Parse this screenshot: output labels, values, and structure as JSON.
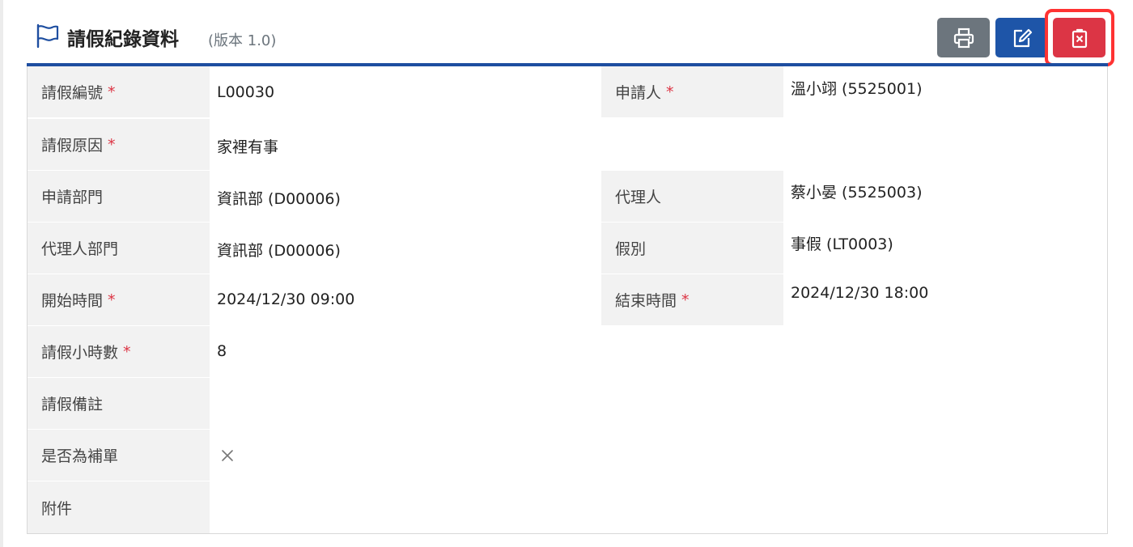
{
  "header": {
    "title": "請假紀錄資料",
    "version": "(版本 1.0)"
  },
  "toolbar": {
    "print_icon": "printer-icon",
    "edit_icon": "edit-icon",
    "delete_icon": "delete-icon"
  },
  "form": {
    "required_mark": "*",
    "fields": {
      "leave_no": {
        "label": "請假編號",
        "value": "L00030"
      },
      "applicant": {
        "label": "申請人",
        "value": "溫小翊 (5525001)"
      },
      "reason": {
        "label": "請假原因",
        "value": "家裡有事"
      },
      "dept": {
        "label": "申請部門",
        "value": "資訊部 (D00006)"
      },
      "agent": {
        "label": "代理人",
        "value": "蔡小晏 (5525003)"
      },
      "agent_dept": {
        "label": "代理人部門",
        "value": "資訊部 (D00006)"
      },
      "leave_type": {
        "label": "假別",
        "value": "事假 (LT0003)"
      },
      "start_time": {
        "label": "開始時間",
        "value": "2024/12/30 09:00"
      },
      "end_time": {
        "label": "結束時間",
        "value": "2024/12/30 18:00"
      },
      "hours": {
        "label": "請假小時數",
        "value": "8"
      },
      "remark": {
        "label": "請假備註",
        "value": ""
      },
      "supplement": {
        "label": "是否為補單",
        "value_icon": "x-icon"
      },
      "attachment": {
        "label": "附件",
        "value": ""
      }
    }
  },
  "colors": {
    "accent": "#1e4ea0",
    "print_button": "#6c757d",
    "edit_button": "#1e55a8",
    "delete_button": "#dc3545",
    "highlight": "#ff3333",
    "required": "#dc3545"
  }
}
